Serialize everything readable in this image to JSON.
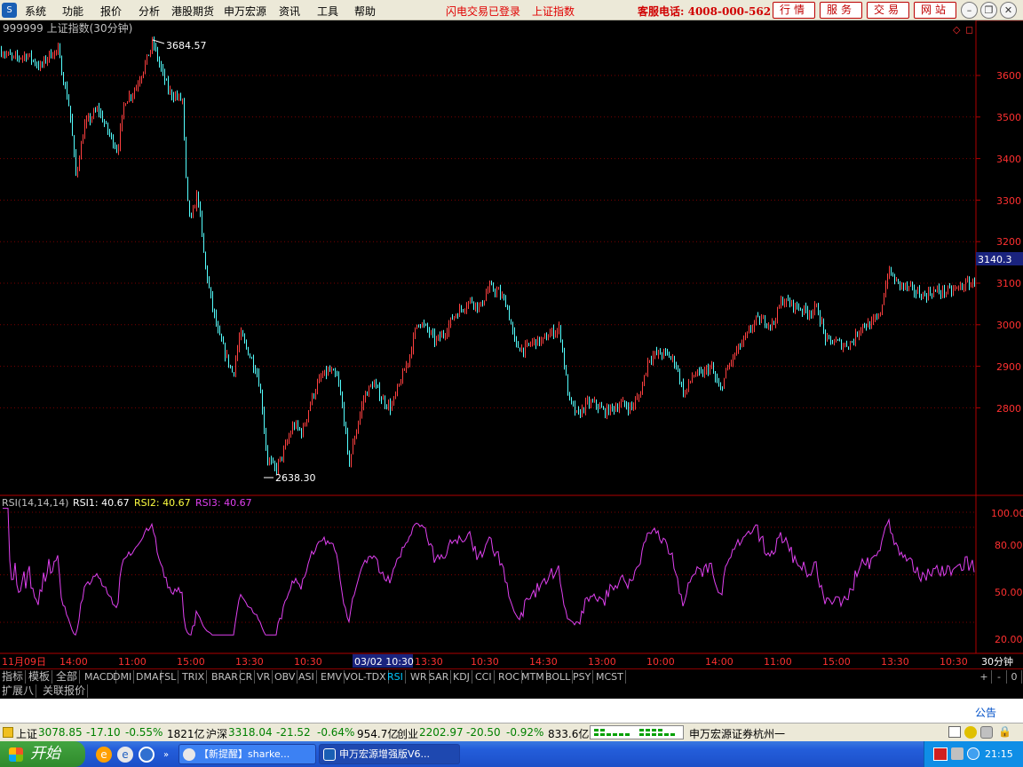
{
  "menubar": {
    "items": [
      "系统",
      "功能",
      "报价",
      "分析",
      "港股期货",
      "申万宏源",
      "资讯",
      "工具",
      "帮助"
    ],
    "status_login": "闪电交易已登录",
    "status_index": "上证指数",
    "hotline": "客服电话: 4008-000-562",
    "buttons": [
      "行情",
      "服务",
      "交易",
      "网站"
    ]
  },
  "chart": {
    "title": "999999 上证指数(30分钟)",
    "high_label": "3684.57",
    "low_label": "2638.30",
    "current_price": "3140.3",
    "price_ticks": [
      "3600",
      "3500",
      "3400",
      "3300",
      "3200",
      "3100",
      "3000",
      "2900",
      "2800"
    ],
    "rsi_title": "RSI(14,14,14)",
    "rsi1_label": "RSI1: 40.67",
    "rsi2_label": "RSI2: 40.67",
    "rsi3_label": "RSI3: 40.67",
    "rsi_ticks": [
      "100.00",
      "80.00",
      "50.00",
      "20.00"
    ],
    "time_labels": [
      "11月09日",
      "14:00",
      "11:00",
      "15:00",
      "13:30",
      "10:30",
      "03/02 10:30",
      "13:30",
      "10:30",
      "14:30",
      "13:00",
      "10:00",
      "14:00",
      "11:00",
      "15:00",
      "13:30",
      "10:30"
    ],
    "period_label": "30分钟",
    "colors": {
      "up": "#ff4040",
      "down": "#54ffff",
      "rsi": "#e040f0",
      "axis": "#b00000",
      "grid": "#7a0000"
    }
  },
  "chart_data": {
    "type": "candlestick",
    "title": "999999 上证指数(30分钟)",
    "high": 3684.57,
    "low": 2638.3,
    "current": 3140.3,
    "ylim": [
      2640,
      3700
    ],
    "y_ticks": [
      2800,
      2900,
      3000,
      3100,
      3200,
      3300,
      3400,
      3500,
      3600
    ],
    "anchors": [
      [
        0,
        3660
      ],
      [
        15,
        3640
      ],
      [
        30,
        3650
      ],
      [
        45,
        3620
      ],
      [
        55,
        3650
      ],
      [
        65,
        3660
      ],
      [
        70,
        3600
      ],
      [
        78,
        3520
      ],
      [
        85,
        3360
      ],
      [
        95,
        3480
      ],
      [
        110,
        3520
      ],
      [
        120,
        3470
      ],
      [
        132,
        3420
      ],
      [
        140,
        3540
      ],
      [
        150,
        3560
      ],
      [
        160,
        3610
      ],
      [
        172,
        3680
      ],
      [
        180,
        3620
      ],
      [
        190,
        3560
      ],
      [
        205,
        3540
      ],
      [
        210,
        3300
      ],
      [
        215,
        3250
      ],
      [
        222,
        3320
      ],
      [
        230,
        3150
      ],
      [
        238,
        3050
      ],
      [
        245,
        2980
      ],
      [
        255,
        2920
      ],
      [
        262,
        2880
      ],
      [
        270,
        2980
      ],
      [
        280,
        2930
      ],
      [
        290,
        2880
      ],
      [
        295,
        2800
      ],
      [
        300,
        2680
      ],
      [
        310,
        2650
      ],
      [
        320,
        2700
      ],
      [
        330,
        2760
      ],
      [
        340,
        2740
      ],
      [
        350,
        2820
      ],
      [
        360,
        2870
      ],
      [
        370,
        2890
      ],
      [
        380,
        2870
      ],
      [
        388,
        2760
      ],
      [
        392,
        2660
      ],
      [
        400,
        2740
      ],
      [
        410,
        2830
      ],
      [
        420,
        2860
      ],
      [
        430,
        2820
      ],
      [
        440,
        2800
      ],
      [
        450,
        2860
      ],
      [
        460,
        2920
      ],
      [
        470,
        3010
      ],
      [
        480,
        2990
      ],
      [
        490,
        2960
      ],
      [
        500,
        2980
      ],
      [
        510,
        3020
      ],
      [
        520,
        3040
      ],
      [
        530,
        3060
      ],
      [
        540,
        3040
      ],
      [
        550,
        3090
      ],
      [
        560,
        3080
      ],
      [
        570,
        3050
      ],
      [
        580,
        2950
      ],
      [
        590,
        2940
      ],
      [
        600,
        2960
      ],
      [
        610,
        2960
      ],
      [
        620,
        2980
      ],
      [
        630,
        2990
      ],
      [
        640,
        2820
      ],
      [
        650,
        2780
      ],
      [
        660,
        2810
      ],
      [
        670,
        2810
      ],
      [
        680,
        2790
      ],
      [
        690,
        2800
      ],
      [
        700,
        2810
      ],
      [
        710,
        2800
      ],
      [
        720,
        2830
      ],
      [
        730,
        2920
      ],
      [
        740,
        2930
      ],
      [
        750,
        2930
      ],
      [
        760,
        2910
      ],
      [
        770,
        2830
      ],
      [
        780,
        2880
      ],
      [
        790,
        2880
      ],
      [
        800,
        2900
      ],
      [
        810,
        2840
      ],
      [
        820,
        2900
      ],
      [
        830,
        2940
      ],
      [
        840,
        2970
      ],
      [
        850,
        3010
      ],
      [
        860,
        3010
      ],
      [
        870,
        3000
      ],
      [
        880,
        3060
      ],
      [
        890,
        3050
      ],
      [
        900,
        3040
      ],
      [
        910,
        3030
      ],
      [
        920,
        3040
      ],
      [
        930,
        2960
      ],
      [
        940,
        2960
      ],
      [
        950,
        2950
      ],
      [
        960,
        2960
      ],
      [
        970,
        3000
      ],
      [
        980,
        3000
      ],
      [
        990,
        3020
      ],
      [
        1000,
        3130
      ],
      [
        1010,
        3100
      ],
      [
        1020,
        3090
      ],
      [
        1030,
        3080
      ],
      [
        1040,
        3070
      ],
      [
        1050,
        3080
      ],
      [
        1060,
        3080
      ],
      [
        1070,
        3080
      ],
      [
        1080,
        3090
      ],
      [
        1090,
        3100
      ],
      [
        1098,
        3100
      ]
    ],
    "rsi": {
      "name": "RSI(14,14,14)",
      "RSI1": 40.67,
      "RSI2": 40.67,
      "RSI3": 40.67,
      "y_ticks": [
        20,
        50,
        80,
        100
      ],
      "ylim": [
        10,
        110
      ]
    }
  },
  "tabs": {
    "items": [
      "指标",
      "模板",
      "全部",
      "MACD",
      "DMI",
      "DMA",
      "FSL",
      "TRIX",
      "BRAR",
      "CR",
      "VR",
      "OBV",
      "ASI",
      "EMV",
      "VOL-TDX",
      "RSI",
      "WR",
      "SAR",
      "KDJ",
      "CCI",
      "ROC",
      "MTM",
      "BOLL",
      "PSY",
      "MCST"
    ],
    "active": "RSI",
    "right_buttons": [
      "+",
      "-",
      "0"
    ],
    "row2": [
      "扩展八",
      "关联报价"
    ]
  },
  "notice": "公告",
  "statusbar": {
    "sh_name": "上证",
    "sh_price": "3078.85",
    "sh_change": "-17.10",
    "sh_pct": "-0.55%",
    "sh_vol": "1821亿",
    "hs_name": "沪深",
    "hs_price": "3318.04",
    "hs_change": "-21.52",
    "hs_pct": "-0.64%",
    "hs_vol": "954.7亿",
    "cy_name": "创业",
    "cy_price": "2202.97",
    "cy_change": "-20.50",
    "cy_pct": "-0.92%",
    "cy_vol": "833.6亿",
    "broker": "申万宏源证券杭州一"
  },
  "taskbar": {
    "start": "开始",
    "items": [
      "【新提醒】sharke...",
      "申万宏源增强版V6..."
    ],
    "time": "21:15"
  }
}
